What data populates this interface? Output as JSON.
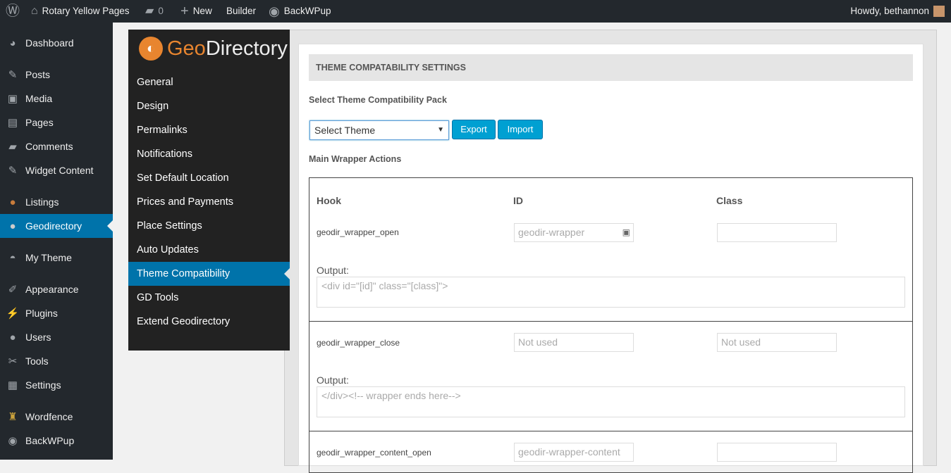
{
  "adminbar": {
    "site": "Rotary Yellow Pages",
    "comments": "0",
    "new": "New",
    "builder": "Builder",
    "backwpup": "BackWPup",
    "howdy": "Howdy, bethannon"
  },
  "menu": [
    "Dashboard",
    "Posts",
    "Media",
    "Pages",
    "Comments",
    "Widget Content",
    "Listings",
    "Geodirectory",
    "My Theme",
    "Appearance",
    "Plugins",
    "Users",
    "Tools",
    "Settings",
    "Wordfence",
    "BackWPup"
  ],
  "gd": {
    "logo_geo": "Geo",
    "logo_dir": "Directory",
    "items": [
      "General",
      "Design",
      "Permalinks",
      "Notifications",
      "Set Default Location",
      "Prices and Payments",
      "Place Settings",
      "Auto Updates",
      "Theme Compatibility",
      "GD Tools",
      "Extend Geodirectory"
    ]
  },
  "main": {
    "header": "THEME COMPATABILITY SETTINGS",
    "select_label": "Select Theme Compatibility Pack",
    "select_value": "Select Theme",
    "export": "Export",
    "import": "Import",
    "section": "Main Wrapper Actions",
    "cols": [
      "Hook",
      "ID",
      "Class"
    ],
    "output_label": "Output:",
    "rows": [
      {
        "hook": "geodir_wrapper_open",
        "id": "geodir-wrapper",
        "class": "",
        "output": "<div id=\"[id]\" class=\"[class]\">"
      },
      {
        "hook": "geodir_wrapper_close",
        "id": "Not used",
        "class": "Not used",
        "output": "</div><!-- wrapper ends here-->"
      },
      {
        "hook": "geodir_wrapper_content_open",
        "id": "geodir-wrapper-content",
        "class": ""
      }
    ]
  }
}
